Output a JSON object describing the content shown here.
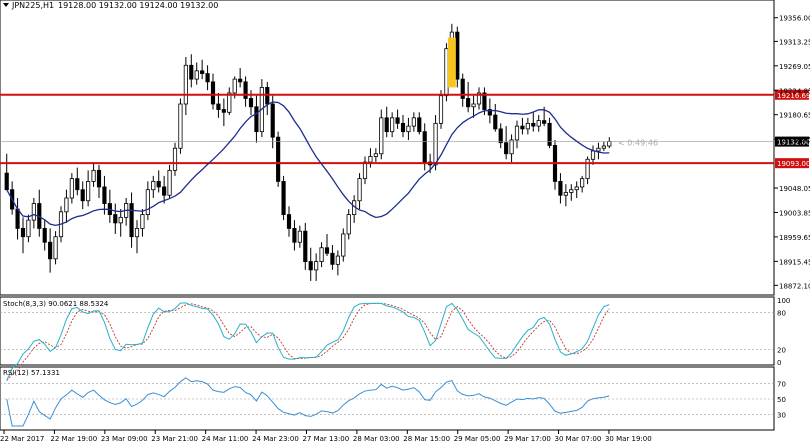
{
  "header": {
    "symbol": "JPN225,H1",
    "ohlc": "19128.00 19132.00 19124.00 19132.00"
  },
  "colors": {
    "background": "#ffffff",
    "bull_candle": "#ffffff",
    "bear_candle": "#000000",
    "candle_outline": "#000000",
    "moving_average": "#1f2d8f",
    "resistance_lines": "#d01010",
    "stoch_main": "#2ab0c9",
    "stoch_signal": "#c0392b",
    "rsi": "#3a8fd6",
    "highlight_box": "#f7c51e",
    "level_line": "#9a9a9a",
    "grid_dotted": "#9a9a9a"
  },
  "price_axis": {
    "ticks": [
      "19356.00",
      "19313.25",
      "19269.05",
      "19224.85",
      "19180.65",
      "19136.45",
      "19048.05",
      "19003.85",
      "18959.65",
      "18915.45",
      "18872.10"
    ],
    "current_price": "19132.00",
    "resistance_1": "19216.69",
    "resistance_2": "19093.00",
    "countdown": "< 0:49:46"
  },
  "stochastic": {
    "label": "Stoch(8,3,3) 90.0621 88.5324",
    "ticks": [
      "100",
      "80",
      "20",
      "0"
    ]
  },
  "rsi": {
    "label": "RSI(12) 57.1331",
    "ticks": [
      "70",
      "50",
      "30"
    ]
  },
  "time_axis": {
    "labels": [
      "22 Mar 2017",
      "22 Mar 19:00",
      "23 Mar 09:00",
      "23 Mar 21:00",
      "24 Mar 11:00",
      "24 Mar 23:00",
      "27 Mar 13:00",
      "28 Mar 03:00",
      "28 Mar 15:00",
      "29 Mar 05:00",
      "29 Mar 17:00",
      "30 Mar 07:00",
      "30 Mar 19:00"
    ]
  },
  "chart_data": {
    "type": "candlestick",
    "symbol": "JPN225",
    "timeframe": "H1",
    "ylim": [
      18860,
      19370
    ],
    "resistance_levels": [
      19216.69,
      19093.0
    ],
    "current_price": 19132.0,
    "candles": [
      [
        19075,
        19110,
        19060,
        19045
      ],
      [
        19045,
        19060,
        19000,
        19010
      ],
      [
        19010,
        19030,
        18955,
        18975
      ],
      [
        18975,
        18995,
        18930,
        18960
      ],
      [
        18960,
        19000,
        18950,
        18990
      ],
      [
        18990,
        19030,
        18975,
        19020
      ],
      [
        19020,
        19045,
        18960,
        18975
      ],
      [
        18975,
        18990,
        18935,
        18950
      ],
      [
        18950,
        18975,
        18895,
        18920
      ],
      [
        18920,
        18970,
        18910,
        18960
      ],
      [
        18960,
        19015,
        18950,
        19005
      ],
      [
        19005,
        19045,
        18985,
        19030
      ],
      [
        19030,
        19075,
        19020,
        19065
      ],
      [
        19065,
        19085,
        19035,
        19045
      ],
      [
        19045,
        19060,
        19010,
        19025
      ],
      [
        19025,
        19080,
        19015,
        19060
      ],
      [
        19060,
        19095,
        19050,
        19080
      ],
      [
        19080,
        19090,
        19030,
        19050
      ],
      [
        19050,
        19070,
        19000,
        19020
      ],
      [
        19020,
        19045,
        18985,
        19000
      ],
      [
        19000,
        19020,
        18965,
        18985
      ],
      [
        18985,
        19010,
        18960,
        18995
      ],
      [
        18995,
        19030,
        18980,
        19020
      ],
      [
        19020,
        19040,
        18940,
        18960
      ],
      [
        18960,
        18990,
        18930,
        18975
      ],
      [
        18975,
        19010,
        18960,
        19000
      ],
      [
        19000,
        19060,
        18990,
        19045
      ],
      [
        19045,
        19070,
        19030,
        19060
      ],
      [
        19060,
        19080,
        19040,
        19050
      ],
      [
        19050,
        19070,
        19020,
        19035
      ],
      [
        19035,
        19090,
        19030,
        19080
      ],
      [
        19080,
        19130,
        19070,
        19120
      ],
      [
        19120,
        19210,
        19110,
        19200
      ],
      [
        19200,
        19285,
        19180,
        19270
      ],
      [
        19270,
        19290,
        19230,
        19245
      ],
      [
        19245,
        19275,
        19235,
        19260
      ],
      [
        19260,
        19280,
        19245,
        19255
      ],
      [
        19255,
        19270,
        19225,
        19240
      ],
      [
        19240,
        19255,
        19190,
        19200
      ],
      [
        19200,
        19220,
        19175,
        19190
      ],
      [
        19190,
        19210,
        19160,
        19185
      ],
      [
        19185,
        19230,
        19180,
        19220
      ],
      [
        19220,
        19250,
        19210,
        19245
      ],
      [
        19245,
        19265,
        19230,
        19240
      ],
      [
        19240,
        19250,
        19195,
        19210
      ],
      [
        19210,
        19225,
        19180,
        19195
      ],
      [
        19195,
        19215,
        19130,
        19150
      ],
      [
        19150,
        19245,
        19140,
        19230
      ],
      [
        19230,
        19240,
        19180,
        19200
      ],
      [
        19200,
        19215,
        19120,
        19140
      ],
      [
        19140,
        19150,
        19050,
        19060
      ],
      [
        19060,
        19070,
        18990,
        19000
      ],
      [
        19000,
        19015,
        18960,
        18975
      ],
      [
        18975,
        18990,
        18935,
        18950
      ],
      [
        18950,
        18980,
        18940,
        18970
      ],
      [
        18970,
        18985,
        18900,
        18915
      ],
      [
        18915,
        18940,
        18880,
        18900
      ],
      [
        18900,
        18930,
        18880,
        18915
      ],
      [
        18915,
        18950,
        18905,
        18940
      ],
      [
        18940,
        18965,
        18925,
        18930
      ],
      [
        18930,
        18945,
        18900,
        18910
      ],
      [
        18910,
        18935,
        18890,
        18925
      ],
      [
        18925,
        18975,
        18915,
        18965
      ],
      [
        18965,
        19010,
        18955,
        19000
      ],
      [
        19000,
        19035,
        18985,
        19025
      ],
      [
        19025,
        19075,
        19010,
        19065
      ],
      [
        19065,
        19105,
        19055,
        19095
      ],
      [
        19095,
        19120,
        19085,
        19105
      ],
      [
        19105,
        19120,
        19095,
        19110
      ],
      [
        19110,
        19190,
        19100,
        19175
      ],
      [
        19175,
        19195,
        19140,
        19150
      ],
      [
        19150,
        19185,
        19140,
        19175
      ],
      [
        19175,
        19190,
        19155,
        19165
      ],
      [
        19165,
        19180,
        19140,
        19150
      ],
      [
        19150,
        19175,
        19135,
        19160
      ],
      [
        19160,
        19185,
        19150,
        19175
      ],
      [
        19175,
        19185,
        19145,
        19150
      ],
      [
        19150,
        19165,
        19080,
        19095
      ],
      [
        19095,
        19110,
        19075,
        19090
      ],
      [
        19090,
        19180,
        19080,
        19165
      ],
      [
        19165,
        19225,
        19155,
        19215
      ],
      [
        19215,
        19310,
        19205,
        19300
      ],
      [
        19300,
        19345,
        19285,
        19330
      ],
      [
        19330,
        19340,
        19230,
        19245
      ],
      [
        19245,
        19255,
        19195,
        19210
      ],
      [
        19210,
        19240,
        19185,
        19195
      ],
      [
        19195,
        19215,
        19175,
        19200
      ],
      [
        19200,
        19230,
        19190,
        19220
      ],
      [
        19220,
        19230,
        19180,
        19190
      ],
      [
        19190,
        19210,
        19165,
        19180
      ],
      [
        19180,
        19200,
        19150,
        19155
      ],
      [
        19155,
        19165,
        19120,
        19130
      ],
      [
        19130,
        19160,
        19100,
        19110
      ],
      [
        19110,
        19145,
        19095,
        19135
      ],
      [
        19135,
        19170,
        19120,
        19160
      ],
      [
        19160,
        19175,
        19145,
        19155
      ],
      [
        19155,
        19175,
        19145,
        19165
      ],
      [
        19165,
        19185,
        19150,
        19160
      ],
      [
        19160,
        19180,
        19150,
        19170
      ],
      [
        19170,
        19195,
        19160,
        19165
      ],
      [
        19165,
        19175,
        19120,
        19125
      ],
      [
        19125,
        19135,
        19045,
        19060
      ],
      [
        19060,
        19075,
        19020,
        19035
      ],
      [
        19035,
        19055,
        19015,
        19040
      ],
      [
        19040,
        19055,
        19025,
        19045
      ],
      [
        19045,
        19060,
        19030,
        19050
      ],
      [
        19050,
        19070,
        19040,
        19065
      ],
      [
        19065,
        19105,
        19055,
        19100
      ],
      [
        19100,
        19125,
        19090,
        19115
      ],
      [
        19115,
        19130,
        19100,
        19120
      ],
      [
        19120,
        19132,
        19115,
        19124
      ],
      [
        19124,
        19140,
        19120,
        19132
      ]
    ],
    "highlight": {
      "price_from": 19230,
      "price_to": 19320
    },
    "stochastic": {
      "name": "Stoch(8,3,3)",
      "main": 90.0621,
      "signal": 88.5324,
      "levels": [
        80,
        20
      ],
      "ylim": [
        0,
        100
      ]
    },
    "rsi": {
      "name": "RSI(12)",
      "value": 57.1331,
      "levels": [
        70,
        50,
        30
      ],
      "ylim": [
        15,
        85
      ]
    }
  }
}
